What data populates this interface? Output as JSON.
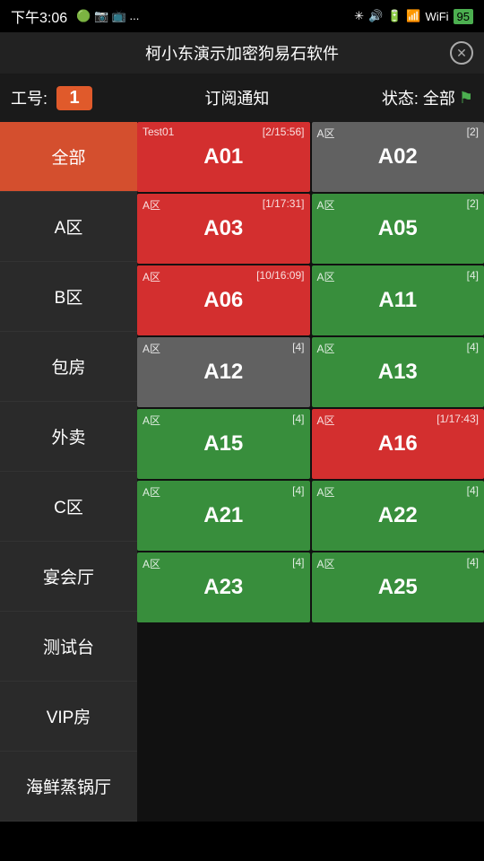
{
  "statusBar": {
    "time": "下午3:06",
    "leftIcons": [
      "📱",
      "📷",
      "📺",
      "..."
    ],
    "battery": "95"
  },
  "titleBar": {
    "title": "柯小东演示加密狗易石软件",
    "closeLabel": "✕"
  },
  "workerBar": {
    "label": "工号:",
    "badge": "1",
    "notify": "订阅通知",
    "statusLabel": "状态: 全部"
  },
  "sidebar": {
    "items": [
      {
        "id": "all",
        "label": "全部",
        "active": true
      },
      {
        "id": "a",
        "label": "A区",
        "active": false
      },
      {
        "id": "b",
        "label": "B区",
        "active": false
      },
      {
        "id": "room",
        "label": "包房",
        "active": false
      },
      {
        "id": "takeout",
        "label": "外卖",
        "active": false
      },
      {
        "id": "c",
        "label": "C区",
        "active": false
      },
      {
        "id": "banquet",
        "label": "宴会厅",
        "active": false
      },
      {
        "id": "test",
        "label": "测试台",
        "active": false
      },
      {
        "id": "vip",
        "label": "VIP房",
        "active": false
      },
      {
        "id": "seafood",
        "label": "海鲜蒸锅厅",
        "active": false
      }
    ]
  },
  "tables": {
    "rows": [
      {
        "cells": [
          {
            "color": "red",
            "badge": "[2/15:56]",
            "tagTop": "Test01",
            "title": "A01",
            "subtitle": ""
          },
          {
            "color": "gray",
            "badge": "[2]",
            "tagTop": "A区",
            "title": "A02",
            "subtitle": ""
          }
        ]
      },
      {
        "cells": [
          {
            "color": "red",
            "badge": "[1/17:31]",
            "tagTop": "A区",
            "title": "A03",
            "subtitle": ""
          },
          {
            "color": "green",
            "badge": "[2]",
            "tagTop": "A区",
            "title": "A05",
            "subtitle": ""
          }
        ]
      },
      {
        "cells": [
          {
            "color": "red",
            "badge": "[10/16:09]",
            "tagTop": "A区",
            "title": "A06",
            "subtitle": ""
          },
          {
            "color": "green",
            "badge": "[4]",
            "tagTop": "A区",
            "title": "A11",
            "subtitle": ""
          }
        ]
      },
      {
        "cells": [
          {
            "color": "gray",
            "badge": "[4]",
            "tagTop": "A区",
            "title": "A12",
            "subtitle": ""
          },
          {
            "color": "green",
            "badge": "[4]",
            "tagTop": "A区",
            "title": "A13",
            "subtitle": ""
          }
        ]
      },
      {
        "cells": [
          {
            "color": "green",
            "badge": "[4]",
            "tagTop": "A区",
            "title": "A15",
            "subtitle": ""
          },
          {
            "color": "red",
            "badge": "[1/17:43]",
            "tagTop": "A区",
            "title": "A16",
            "subtitle": ""
          }
        ]
      },
      {
        "cells": [
          {
            "color": "green",
            "badge": "[4]",
            "tagTop": "A区",
            "title": "A21",
            "subtitle": ""
          },
          {
            "color": "green",
            "badge": "[4]",
            "tagTop": "A区",
            "title": "A22",
            "subtitle": ""
          }
        ]
      },
      {
        "cells": [
          {
            "color": "green",
            "badge": "[4]",
            "tagTop": "A区",
            "title": "A23",
            "subtitle": ""
          },
          {
            "color": "green",
            "badge": "[4]",
            "tagTop": "A区",
            "title": "A25",
            "subtitle": ""
          }
        ]
      }
    ]
  }
}
